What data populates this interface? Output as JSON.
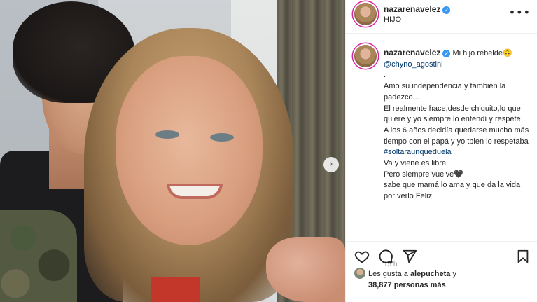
{
  "post": {
    "username": "nazarenavelez",
    "subtitle": "HIJO"
  },
  "caption": {
    "username": "nazarenavelez",
    "title": "Mi hijo rebelde",
    "title_emoji": "🙃",
    "mention": "@chyno_agostini",
    "dot": ".",
    "lines": [
      "Amo su independencia y también la padezco...",
      "El realmente hace,desde chiquito,lo que quiere y yo siempre lo entendí y respete",
      "A los 6 años decidía quedarse mucho más tiempo con el papá y yo tbien lo respetaba"
    ],
    "hashtag": "#soltaraunqueduela",
    "lines_after": [
      "Va y viene es libre",
      "Pero siempre vuelve🖤",
      "sabe que mamá lo ama y que da la vida por verlo Feliz"
    ],
    "time": "15 h"
  },
  "likes": {
    "prefix": "Les gusta a",
    "user": "alepucheta",
    "connector": "y",
    "count": "38,877 personas más"
  },
  "icons": {
    "more": "more-options-icon",
    "next": "chevron-right-icon",
    "like": "heart-icon",
    "comment": "comment-icon",
    "share": "share-icon",
    "save": "bookmark-icon"
  },
  "colors": {
    "verified": "#3897f0",
    "link": "#00376b",
    "muted": "#8e8e8e"
  }
}
